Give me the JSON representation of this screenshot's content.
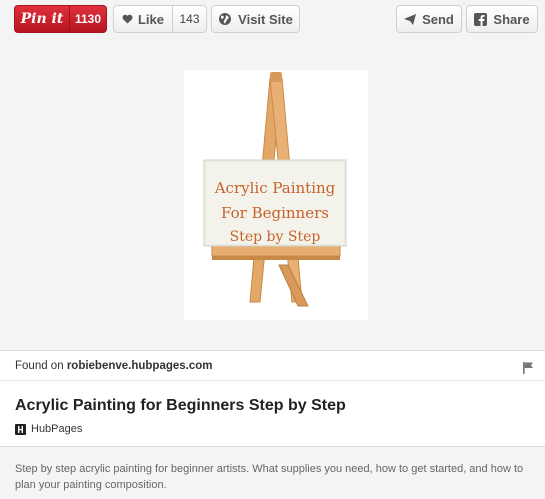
{
  "toolbar": {
    "pin_label": "Pin it",
    "pin_count": "1130",
    "like_label": "Like",
    "like_count": "143",
    "visit_label": "Visit Site",
    "send_label": "Send",
    "share_label": "Share"
  },
  "pin_image": {
    "text_line1": "Acrylic Painting",
    "text_line2": "For Beginners",
    "text_line3": "Step by Step"
  },
  "source": {
    "prefix": "Found on",
    "domain": "robiebenve.hubpages.com"
  },
  "pin": {
    "title": "Acrylic Painting for Beginners Step by Step",
    "board_name": "HubPages",
    "description": "Step by step acrylic painting for beginner artists. What supplies you need, how to get started, and how to plan your painting composition."
  },
  "colors": {
    "pin_red": "#cb2027",
    "background": "#f4f4f4",
    "easel_wood": "#e3a867",
    "canvas_text": "#c8622a"
  }
}
